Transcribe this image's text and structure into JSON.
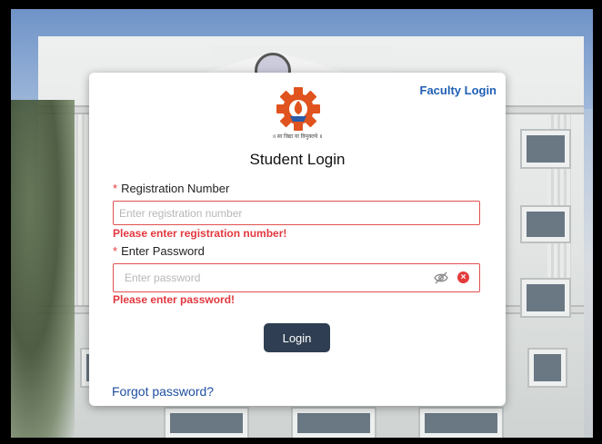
{
  "header": {
    "faculty_login": "Faculty Login"
  },
  "logo": {
    "motto": "॥ सा विद्या या विमुक्तये ॥",
    "gear_color": "#e0531e",
    "flame_color": "#f2a23a",
    "base_color": "#2a5aa8"
  },
  "title": "Student Login",
  "registration": {
    "label": "Registration Number",
    "placeholder": "Enter registration number",
    "error": "Please enter registration number!"
  },
  "password": {
    "label": "Enter Password",
    "placeholder": "Enter password",
    "error": "Please enter password!"
  },
  "login_button": "Login",
  "forgot_password": "Forgot password?",
  "icons": {
    "visibility": "eye-off-icon",
    "clear": "close-circle-icon"
  },
  "colors": {
    "error": "#e2383f",
    "link": "#1f5fb4",
    "button": "#2f3e52"
  }
}
